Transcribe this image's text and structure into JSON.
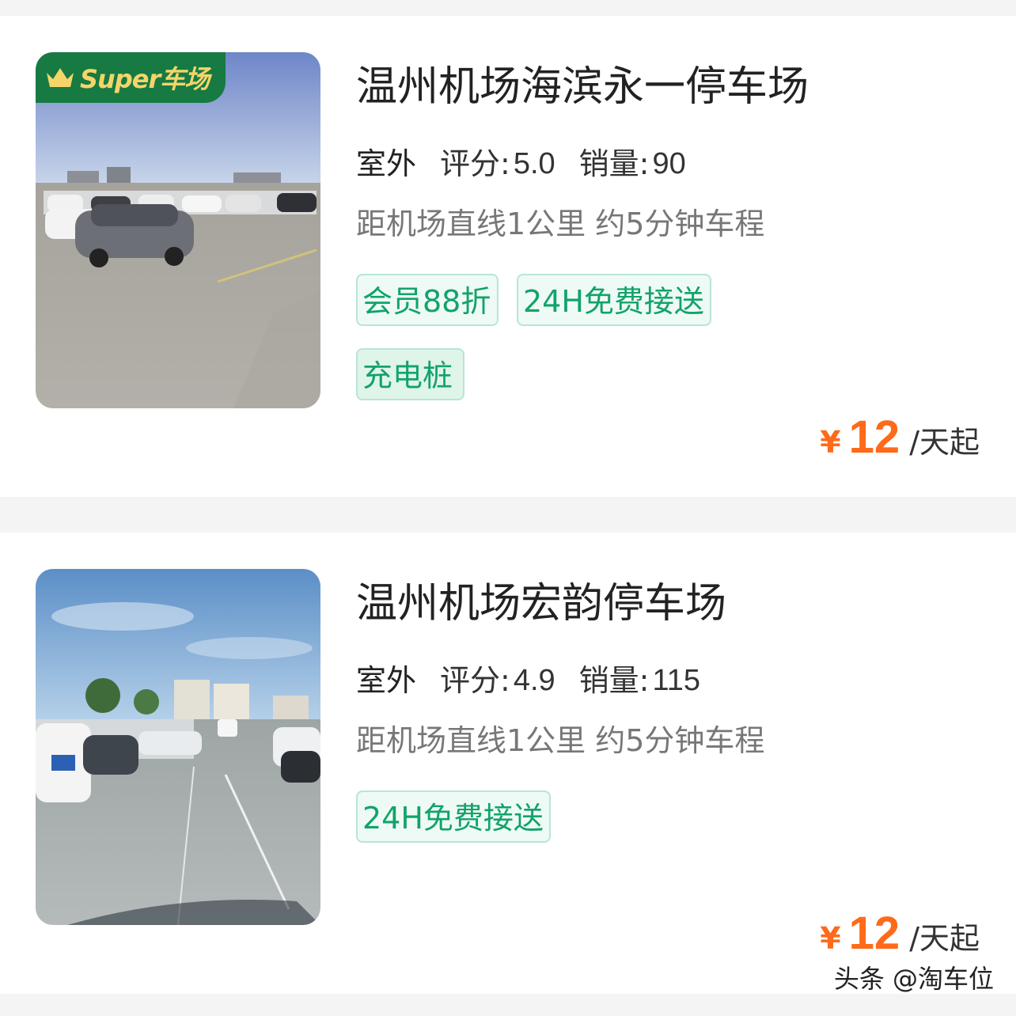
{
  "listings": [
    {
      "badge": "Super车场",
      "title": "温州机场海滨永一停车场",
      "type": "室外",
      "rating_label": "评分:",
      "rating": "5.0",
      "sales_label": "销量:",
      "sales": "90",
      "distance": "距机场直线1公里 约5分钟车程",
      "tags": [
        "会员88折",
        "24H免费接送",
        "充电桩"
      ],
      "currency": "¥",
      "price": "12",
      "price_unit": "/天起"
    },
    {
      "title": "温州机场宏韵停车场",
      "type": "室外",
      "rating_label": "评分:",
      "rating": "4.9",
      "sales_label": "销量:",
      "sales": "115",
      "distance": "距机场直线1公里 约5分钟车程",
      "tags": [
        "24H免费接送"
      ],
      "currency": "¥",
      "price": "12",
      "price_unit": "/天起"
    }
  ],
  "watermark": "头条 @淘车位",
  "colors": {
    "accent_green": "#12a36a",
    "badge_green": "#167a42",
    "price_orange": "#ff6a1a"
  }
}
